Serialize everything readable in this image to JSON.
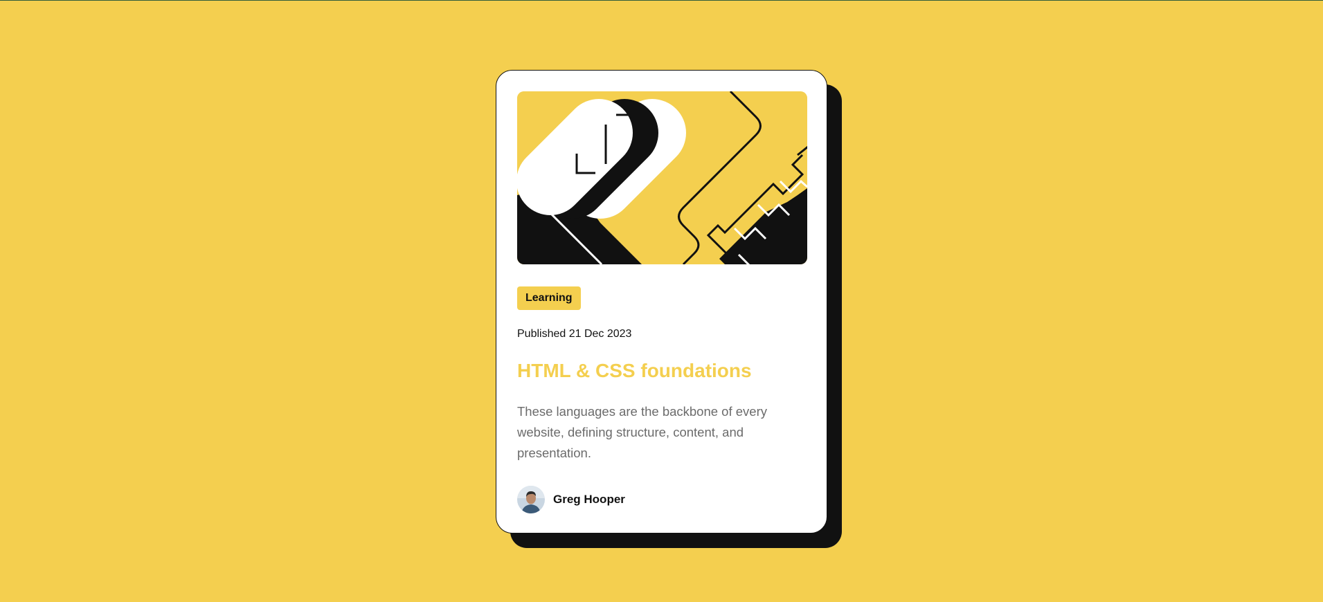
{
  "card": {
    "tag": "Learning",
    "published": "Published 21 Dec 2023",
    "title": "HTML & CSS foundations",
    "description": "These languages are the backbone of every website, defining structure, content, and presentation.",
    "author": {
      "name": "Greg Hooper",
      "avatar_icon": "avatar-photo-icon"
    },
    "illustration_icon": "abstract-illustration-icon"
  },
  "colors": {
    "background": "#F4CF4F",
    "card": "#FFFFFF",
    "ink": "#111111",
    "text_muted": "#6B6B6B",
    "accent": "#F4CF4F"
  }
}
